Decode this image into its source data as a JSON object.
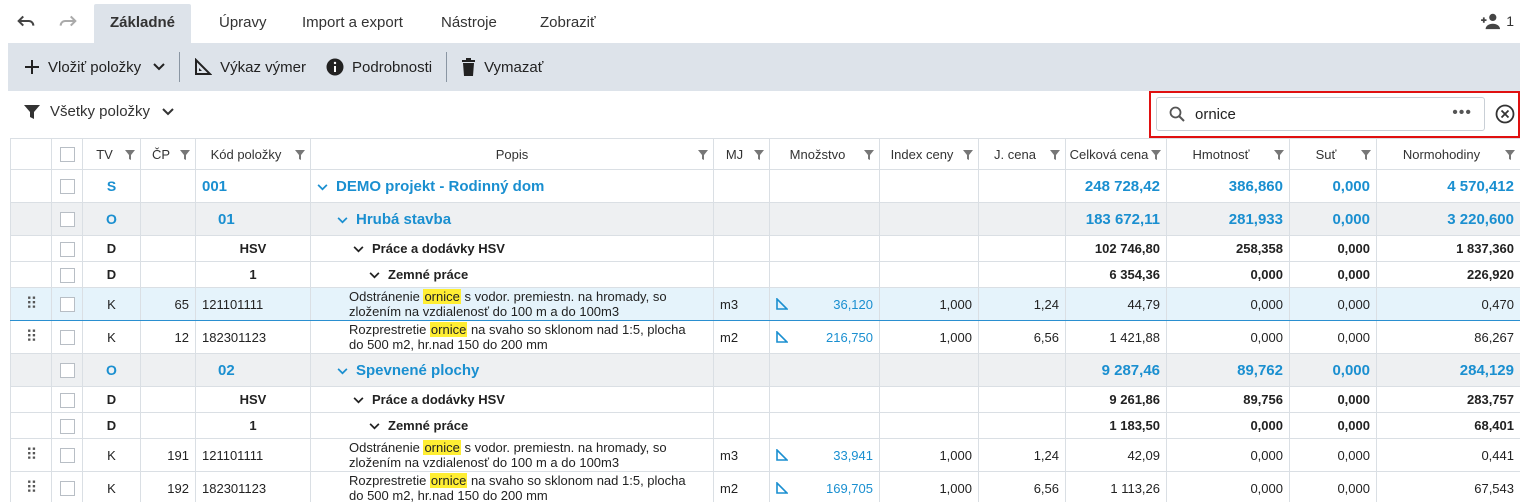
{
  "tabs": [
    {
      "label": "Základné",
      "active": true
    },
    {
      "label": "Úpravy"
    },
    {
      "label": "Import a export"
    },
    {
      "label": "Nástroje"
    },
    {
      "label": "Zobraziť"
    }
  ],
  "user_count": "1",
  "toolbar": {
    "insert_label": "Vložiť položky",
    "measure_label": "Výkaz výmer",
    "details_label": "Podrobnosti",
    "delete_label": "Vymazať"
  },
  "filter": {
    "label": "Všetky položky"
  },
  "search": {
    "value": "ornice",
    "more": "•••"
  },
  "columns": {
    "tv": "TV",
    "cp": "ČP",
    "kod": "Kód položky",
    "popis": "Popis",
    "mj": "MJ",
    "mnozstvo": "Množstvo",
    "index": "Index ceny",
    "jcena": "J. cena",
    "celkova": "Celková cena",
    "hmotnost": "Hmotnosť",
    "sut": "Suť",
    "normohodiny": "Normohodiny"
  },
  "rows": [
    {
      "tv": "S",
      "cp": "",
      "kod": "001",
      "popis": "DEMO projekt - Rodinný dom",
      "celkova": "248 728,42",
      "hmotnost": "386,860",
      "sut": "0,000",
      "normohodiny": "4 570,412"
    },
    {
      "tv": "O",
      "cp": "",
      "kod": "01",
      "popis": "Hrubá stavba",
      "celkova": "183 672,11",
      "hmotnost": "281,933",
      "sut": "0,000",
      "normohodiny": "3 220,600"
    },
    {
      "tv": "D",
      "cp": "",
      "kod": "HSV",
      "popis": "Práce a dodávky HSV",
      "celkova": "102 746,80",
      "hmotnost": "258,358",
      "sut": "0,000",
      "normohodiny": "1 837,360"
    },
    {
      "tv": "D",
      "cp": "",
      "kod": "1",
      "popis": "Zemné práce",
      "celkova": "6 354,36",
      "hmotnost": "0,000",
      "sut": "0,000",
      "normohodiny": "226,920"
    },
    {
      "tv": "K",
      "cp": "65",
      "kod": "121101111",
      "popis_pre": "Odstránenie ",
      "popis_hl": "ornice",
      "popis_post": " s vodor. premiestn. na hromady, so",
      "popis_line2": "zložením na vzdialenosť do 100 m a do 100m3",
      "mj": "m3",
      "mnozstvo": "36,120",
      "index": "1,000",
      "jcena": "1,24",
      "celkova": "44,79",
      "hmotnost": "0,000",
      "sut": "0,000",
      "normohodiny": "0,470"
    },
    {
      "tv": "K",
      "cp": "12",
      "kod": "182301123",
      "popis_pre": "Rozprestretie ",
      "popis_hl": "ornice",
      "popis_post": " na svaho so sklonom nad 1:5, plocha",
      "popis_line2": "do 500 m2, hr.nad 150 do 200 mm",
      "mj": "m2",
      "mnozstvo": "216,750",
      "index": "1,000",
      "jcena": "6,56",
      "celkova": "1 421,88",
      "hmotnost": "0,000",
      "sut": "0,000",
      "normohodiny": "86,267"
    },
    {
      "tv": "O",
      "cp": "",
      "kod": "02",
      "popis": "Spevnené plochy",
      "celkova": "9 287,46",
      "hmotnost": "89,762",
      "sut": "0,000",
      "normohodiny": "284,129"
    },
    {
      "tv": "D",
      "cp": "",
      "kod": "HSV",
      "popis": "Práce a dodávky HSV",
      "celkova": "9 261,86",
      "hmotnost": "89,756",
      "sut": "0,000",
      "normohodiny": "283,757"
    },
    {
      "tv": "D",
      "cp": "",
      "kod": "1",
      "popis": "Zemné práce",
      "celkova": "1 183,50",
      "hmotnost": "0,000",
      "sut": "0,000",
      "normohodiny": "68,401"
    },
    {
      "tv": "K",
      "cp": "191",
      "kod": "121101111",
      "popis_pre": "Odstránenie ",
      "popis_hl": "ornice",
      "popis_post": " s vodor. premiestn. na hromady, so",
      "popis_line2": "zložením na vzdialenosť do 100 m a do 100m3",
      "mj": "m3",
      "mnozstvo": "33,941",
      "index": "1,000",
      "jcena": "1,24",
      "celkova": "42,09",
      "hmotnost": "0,000",
      "sut": "0,000",
      "normohodiny": "0,441"
    },
    {
      "tv": "K",
      "cp": "192",
      "kod": "182301123",
      "popis_pre": "Rozprestretie ",
      "popis_hl": "ornice",
      "popis_post": " na svaho so sklonom nad 1:5, plocha",
      "popis_line2": "do 500 m2, hr.nad 150 do 200 mm",
      "mj": "m2",
      "mnozstvo": "169,705",
      "index": "1,000",
      "jcena": "6,56",
      "celkova": "1 113,26",
      "hmotnost": "0,000",
      "sut": "0,000",
      "normohodiny": "67,543"
    }
  ],
  "colors": {
    "accent": "#1a8fd0",
    "highlight": "#ffee33",
    "toolbar_bg": "#dde3ea",
    "search_outline": "#e01010"
  }
}
